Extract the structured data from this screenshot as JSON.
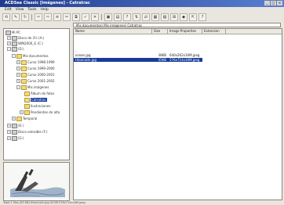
{
  "titlebar": {
    "title": "ACDSee Classic [Imágenes] - Catratrac",
    "btn_min": "_",
    "btn_max": "□",
    "btn_close": "×"
  },
  "menubar": {
    "items": [
      "Edit",
      "View",
      "Tools",
      "Help"
    ]
  },
  "toolbar": {
    "buttons": [
      "⟲",
      "✎",
      "↻",
      "⇦",
      "⇨",
      "≡",
      "✂",
      "⧉",
      "✓",
      "✕",
      "▣",
      "▤",
      "?",
      "⇅",
      "⇄",
      "▦",
      "▧",
      "⊞",
      "◆",
      "⇱",
      "?"
    ]
  },
  "address": {
    "path": "Mis documentos\\ Mis imágenes\\ Catratrac"
  },
  "tree": {
    "items": [
      {
        "label": "Mi PC",
        "kind": "pc"
      },
      {
        "label": "Disco de 3½ (A:)",
        "kind": "drive"
      },
      {
        "label": "WIN2000_G (C:)",
        "kind": "drive"
      },
      {
        "label": "(D:)",
        "kind": "drive"
      },
      {
        "label": "Mis documentos",
        "kind": "folder"
      },
      {
        "label": "Curso 1998-1999",
        "kind": "folder"
      },
      {
        "label": "Curso 1999-2000",
        "kind": "folder"
      },
      {
        "label": "Curso 2000-2001",
        "kind": "folder"
      },
      {
        "label": "Curso 2001-2002",
        "kind": "folder"
      },
      {
        "label": "Mis imágenes",
        "kind": "folder"
      },
      {
        "label": "Álbum de fotos",
        "kind": "folder"
      },
      {
        "label": "Catratrac",
        "kind": "folder",
        "selected": true
      },
      {
        "label": "Ilustraciones",
        "kind": "folder"
      },
      {
        "label": "Pendientes de alta",
        "kind": "folder"
      },
      {
        "label": "Temporal",
        "kind": "folder"
      },
      {
        "label": "(E:)",
        "kind": "drive"
      },
      {
        "label": "Disco extraíble (F:)",
        "kind": "drive"
      },
      {
        "label": "(G:)",
        "kind": "drive"
      }
    ]
  },
  "files": {
    "columns": [
      "Name",
      "Size",
      "Image Properties",
      "Extension"
    ],
    "rows": [
      {
        "name": "..",
        "size": "",
        "props": "",
        "ext": ""
      },
      {
        "name": "ocean.jpg",
        "size": "38KB",
        "props": "640x262x16M.jpeg",
        "ext": ""
      },
      {
        "name": "titanicwin.jpg",
        "size": "45KB",
        "props": "576x714x16M.jpeg",
        "ext": "",
        "selected": true
      }
    ]
  },
  "status": {
    "text": "Total 2 files (83 KB)   titanicwin.jpg   45 KB   576x714x16M.jpeg"
  },
  "colors": {
    "titlebar_from": "#1f3b8f",
    "titlebar_to": "#5a7fd0",
    "selection": "#173b9a"
  }
}
